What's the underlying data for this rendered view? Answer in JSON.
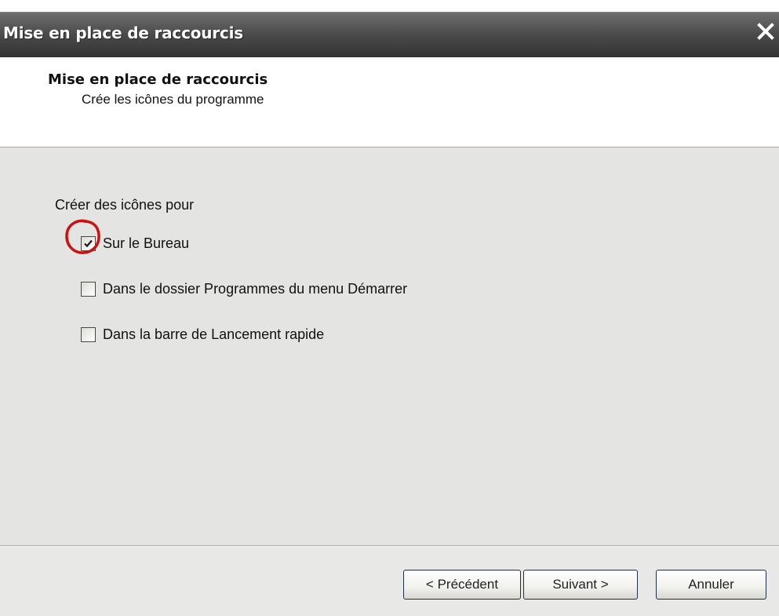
{
  "window": {
    "title": "Mise en place de raccourcis"
  },
  "header": {
    "title": "Mise en place de raccourcis",
    "subtitle": "Crée les icônes du programme"
  },
  "body": {
    "group_label": "Créer des icônes pour",
    "options": [
      {
        "label": "Sur le Bureau",
        "checked": true,
        "highlighted": true
      },
      {
        "label": "Dans le dossier Programmes du menu Démarrer",
        "checked": false
      },
      {
        "label": "Dans la barre de Lancement rapide",
        "checked": false
      }
    ]
  },
  "footer": {
    "prev_label": "< Précédent",
    "next_label": "Suivant >",
    "cancel_label": "Annuler"
  },
  "colors": {
    "titlebar": "#4a4a4a",
    "highlight_circle": "#cc1111",
    "checkbox_border": "#1c5180"
  },
  "icons": {
    "close": "close-icon",
    "check": "checkmark-icon"
  }
}
